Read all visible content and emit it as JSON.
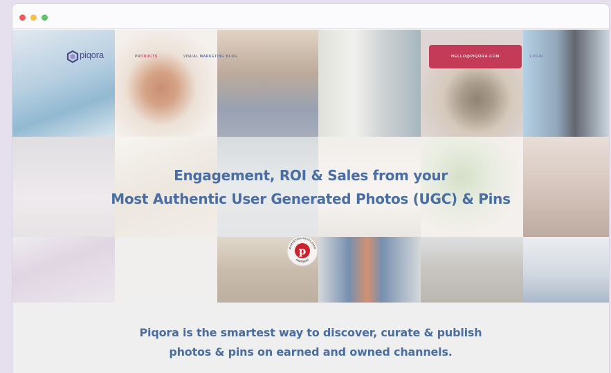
{
  "window": {
    "controls": [
      "close",
      "minimize",
      "maximize"
    ]
  },
  "nav": {
    "logo_text": "piqora",
    "links": {
      "products": "PRODUCTS",
      "blog": "VISUAL MARKETING BLOG",
      "login": "LOGIN"
    },
    "cta_label": "HELLO@PIQORA.COM"
  },
  "hero": {
    "headline_line1": "Engagement, ROI & Sales from your",
    "headline_line2": "Most Authentic User Generated Photos (UGC) & Pins",
    "badge": {
      "top_text": "MARKETING DEVELOPER",
      "bottom_text": "PARTNERS",
      "icon": "pinterest-icon"
    }
  },
  "tagline": {
    "line1": "Piqora is the smartest way to discover, curate & publish",
    "line2": "photos & pins on earned and owned channels."
  },
  "colors": {
    "accent": "#c43b58",
    "headline": "#4a6ea2",
    "logo": "#4b4b8a",
    "pinterest": "#c8232c"
  }
}
